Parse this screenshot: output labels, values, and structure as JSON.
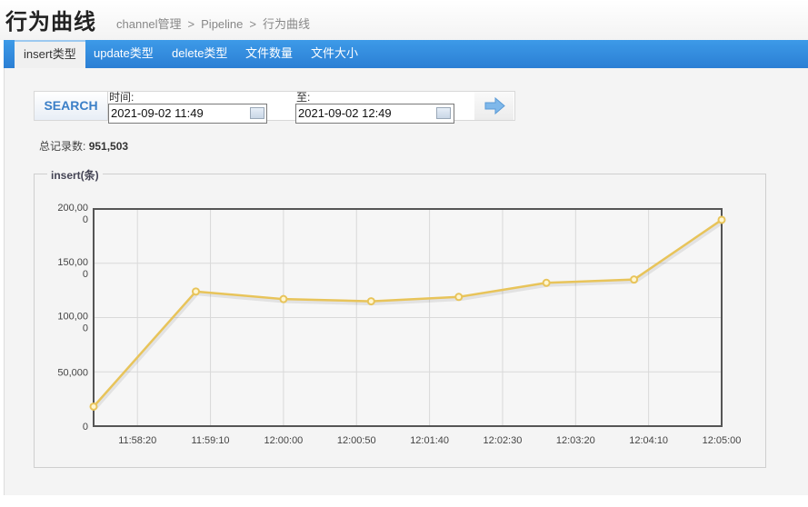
{
  "header": {
    "title": "行为曲线",
    "breadcrumb": [
      "channel管理",
      "Pipeline",
      "行为曲线"
    ]
  },
  "tabs": [
    "insert类型",
    "update类型",
    "delete类型",
    "文件数量",
    "文件大小"
  ],
  "search": {
    "button_label": "SEARCH",
    "from_label": "时间:",
    "from_value": "2021-09-02 11:49",
    "to_label": "至:",
    "to_value": "2021-09-02 12:49"
  },
  "summary": {
    "label": "总记录数:",
    "value": "951,503"
  },
  "chart_panel": {
    "legend": "insert(条)"
  },
  "chart_data": {
    "type": "line",
    "title": "",
    "xlabel": "",
    "ylabel": "",
    "series": [
      {
        "name": "",
        "color": "#e8c45a",
        "x": [
          "11:57:50",
          "11:59:00",
          "12:00:00",
          "12:01:00",
          "12:02:00",
          "12:03:00",
          "12:04:00",
          "12:05:00"
        ],
        "values": [
          18000,
          124000,
          117000,
          115000,
          119000,
          132000,
          135000,
          190000
        ]
      }
    ],
    "ylim": [
      0,
      200000
    ],
    "xlim": [
      "11:57:50",
      "12:05:00"
    ],
    "y_ticks": [
      {
        "value": 0,
        "label": "0"
      },
      {
        "value": 50000,
        "label": "50,000"
      },
      {
        "value": 100000,
        "label": "100,00\n0"
      },
      {
        "value": 150000,
        "label": "150,00\n0"
      },
      {
        "value": 200000,
        "label": "200,00\n0"
      }
    ],
    "x_ticks": [
      "11:58:20",
      "11:59:10",
      "12:00:00",
      "12:00:50",
      "12:01:40",
      "12:02:30",
      "12:03:20",
      "12:04:10",
      "12:05:00"
    ],
    "grid": true,
    "legend": "none"
  }
}
